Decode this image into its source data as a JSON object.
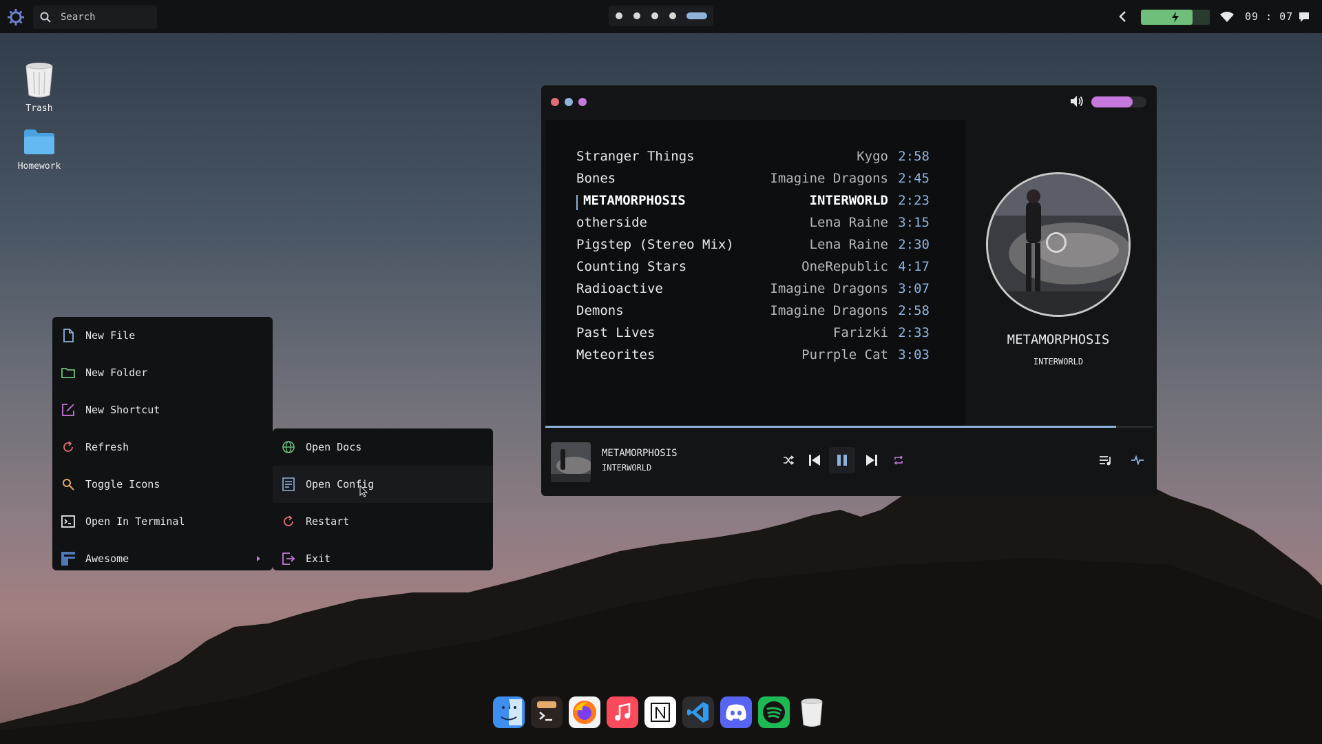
{
  "topbar": {
    "search_placeholder": "Search",
    "clock": "09 : 07",
    "battery_level": 0.75,
    "workspaces": 5,
    "active_workspace": 5
  },
  "desktop": {
    "icons": [
      {
        "label": "Trash",
        "icon": "trash-icon"
      },
      {
        "label": "Homework",
        "icon": "folder-icon"
      }
    ]
  },
  "context_menu": {
    "items": [
      {
        "label": "New File",
        "icon": "file-icon"
      },
      {
        "label": "New Folder",
        "icon": "folder-icon"
      },
      {
        "label": "New Shortcut",
        "icon": "edit-icon"
      },
      {
        "label": "Refresh",
        "icon": "refresh-icon"
      },
      {
        "label": "Toggle Icons",
        "icon": "search-icon"
      },
      {
        "label": "Open In Terminal",
        "icon": "terminal-icon"
      },
      {
        "label": "Awesome",
        "icon": "awesome-icon"
      }
    ],
    "submenu": [
      {
        "label": "Open Docs",
        "icon": "globe-icon"
      },
      {
        "label": "Open Config",
        "icon": "config-icon"
      },
      {
        "label": "Restart",
        "icon": "refresh-icon"
      },
      {
        "label": "Exit",
        "icon": "exit-icon"
      }
    ]
  },
  "player": {
    "volume": 0.75,
    "progress": 0.94,
    "playlist": [
      {
        "title": "Stranger Things",
        "artist": "Kygo",
        "duration": "2:58"
      },
      {
        "title": "Bones",
        "artist": "Imagine Dragons",
        "duration": "2:45"
      },
      {
        "title": "METAMORPHOSIS",
        "artist": "INTERWORLD",
        "duration": "2:23"
      },
      {
        "title": "otherside",
        "artist": "Lena Raine",
        "duration": "3:15"
      },
      {
        "title": "Pigstep (Stereo Mix)",
        "artist": "Lena Raine",
        "duration": "2:30"
      },
      {
        "title": "Counting Stars",
        "artist": "OneRepublic",
        "duration": "4:17"
      },
      {
        "title": "Radioactive",
        "artist": "Imagine Dragons",
        "duration": "3:07"
      },
      {
        "title": "Demons",
        "artist": "Imagine Dragons",
        "duration": "2:58"
      },
      {
        "title": "Past Lives",
        "artist": "Farizki",
        "duration": "2:33"
      },
      {
        "title": "Meteorites",
        "artist": "Purrple Cat",
        "duration": "3:03"
      }
    ],
    "now_playing": {
      "title": "METAMORPHOSIS",
      "artist": "INTERWORLD"
    }
  },
  "dock": {
    "apps": [
      "finder-icon",
      "terminal-icon",
      "firefox-icon",
      "music-icon",
      "notion-icon",
      "vscode-icon",
      "discord-icon",
      "spotify-icon",
      "trash-icon"
    ]
  },
  "colors": {
    "accent_blue": "#8fb2db",
    "accent_purple": "#c678dd",
    "accent_green": "#6fbf7a",
    "surface": "#111214"
  }
}
